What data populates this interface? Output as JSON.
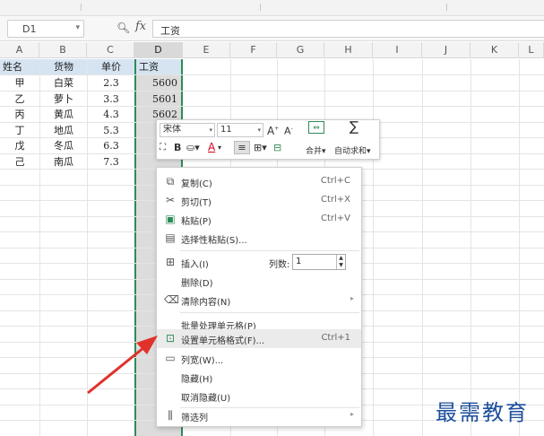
{
  "name_box": {
    "value": "D1"
  },
  "formula_bar": {
    "fx": "fx",
    "value": "工资"
  },
  "columns": [
    "A",
    "B",
    "C",
    "D",
    "E",
    "F",
    "G",
    "H",
    "I",
    "J",
    "K",
    "L"
  ],
  "table": {
    "headers": [
      "姓名",
      "货物",
      "单价",
      "工资"
    ],
    "rows": [
      [
        "甲",
        "白菜",
        "2.3",
        "5600"
      ],
      [
        "乙",
        "萝卜",
        "3.3",
        "5601"
      ],
      [
        "丙",
        "黄瓜",
        "4.3",
        "5602"
      ],
      [
        "丁",
        "地瓜",
        "5.3",
        ""
      ],
      [
        "戊",
        "冬瓜",
        "6.3",
        ""
      ],
      [
        "己",
        "南瓜",
        "7.3",
        ""
      ]
    ]
  },
  "mini_toolbar": {
    "font_name": "宋体",
    "font_size": "11",
    "bold": "B",
    "font_color_letter": "A",
    "merge_label": "合并",
    "autosum_label": "自动求和"
  },
  "context_menu": {
    "items": [
      {
        "label": "复制(C)",
        "shortcut": "Ctrl+C",
        "icon": "copy-icon"
      },
      {
        "label": "剪切(T)",
        "shortcut": "Ctrl+X",
        "icon": "cut-icon"
      },
      {
        "label": "粘贴(P)",
        "shortcut": "Ctrl+V",
        "icon": "paste-icon"
      },
      {
        "label": "选择性粘贴(S)...",
        "shortcut": "",
        "icon": "paste-special-icon"
      },
      {
        "label": "插入(I)",
        "shortcut": "",
        "icon": "insert-icon"
      },
      {
        "label": "删除(D)",
        "shortcut": "",
        "icon": ""
      },
      {
        "label": "清除内容(N)",
        "shortcut": "",
        "icon": "clear-icon"
      },
      {
        "label": "批量处理单元格(P)",
        "shortcut": "",
        "icon": ""
      },
      {
        "label": "设置单元格格式(F)...",
        "shortcut": "Ctrl+1",
        "icon": "format-cells-icon"
      },
      {
        "label": "列宽(W)...",
        "shortcut": "",
        "icon": "column-width-icon"
      },
      {
        "label": "隐藏(H)",
        "shortcut": "",
        "icon": ""
      },
      {
        "label": "取消隐藏(U)",
        "shortcut": "",
        "icon": ""
      },
      {
        "label": "筛选列",
        "shortcut": "",
        "icon": "filter-icon"
      }
    ],
    "columns_count_label": "列数:",
    "columns_count_value": "1"
  },
  "watermark": "最需教育",
  "colors": {
    "selection_border": "#2e8b57",
    "header_fill": "#d6e4f2",
    "arrow": "#e0322b",
    "watermark": "#1d4f9c"
  }
}
